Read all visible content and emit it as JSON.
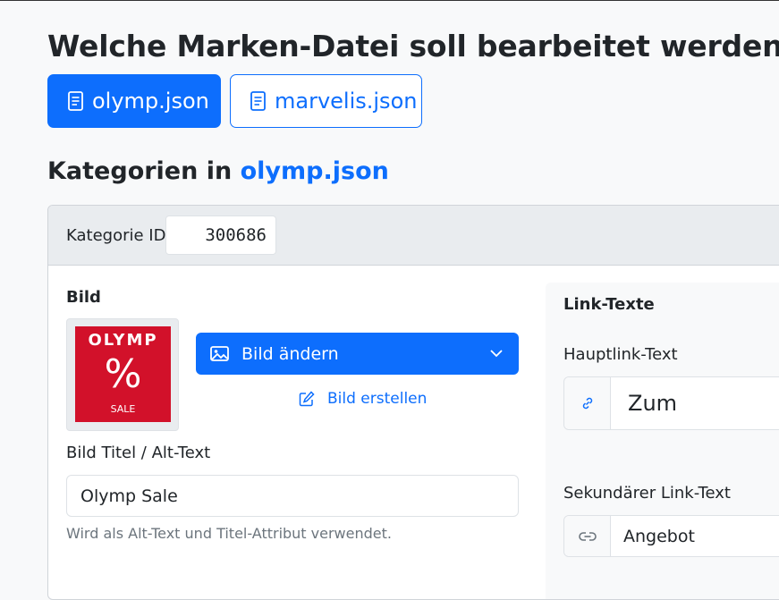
{
  "heading": "Welche Marken-Datei soll bearbeitet werden:",
  "files": [
    {
      "label": "olymp.json",
      "active": true
    },
    {
      "label": "marvelis.json",
      "active": false
    }
  ],
  "categories_heading": {
    "prefix": "Kategorien in",
    "file": "olymp.json"
  },
  "category": {
    "id_label": "Kategorie ID",
    "id_value": "300686"
  },
  "image_section": {
    "title": "Bild",
    "thumbnail": {
      "brand": "OLYMP",
      "symbol": "%",
      "caption": "SALE"
    },
    "change_button": "Bild ändern",
    "create_link": "Bild erstellen",
    "alt_label": "Bild Titel / Alt-Text",
    "alt_value": "Olymp Sale",
    "alt_help": "Wird als Alt-Text und Titel-Attribut verwendet."
  },
  "link_texts": {
    "title": "Link-Texte",
    "main_label": "Hauptlink-Text",
    "main_value": "Zum",
    "secondary_label": "Sekundärer Link-Text",
    "secondary_value": "Angebot"
  },
  "colors": {
    "primary": "#0d6efd",
    "thumbnail_red": "#d2112a",
    "muted": "#6c757d"
  },
  "icons": [
    "file-text-icon",
    "image-icon",
    "chevron-down-icon",
    "pencil-square-icon",
    "link-icon"
  ]
}
